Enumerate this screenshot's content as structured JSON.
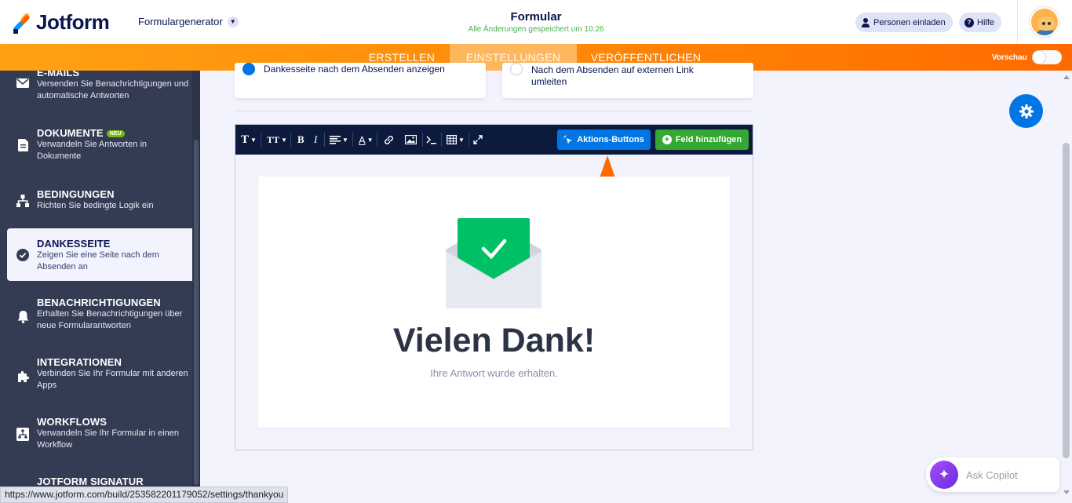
{
  "header": {
    "brand": "Jotform",
    "generator_label": "Formulargenerator",
    "form_title": "Formular",
    "save_status": "Alle Änderungen gespeichert um 10:26",
    "invite_label": "Personen einladen",
    "help_label": "Hilfe"
  },
  "nav": {
    "tabs": [
      {
        "label": "ERSTELLEN",
        "active": false
      },
      {
        "label": "EINSTELLUNGEN",
        "active": true
      },
      {
        "label": "VERÖFFENTLICHEN",
        "active": false
      }
    ],
    "preview_label": "Vorschau",
    "preview_on": false
  },
  "sidebar": {
    "items": [
      {
        "title": "E-MAILS",
        "desc": "Versenden Sie Benachrichtigungen und automatische Antworten",
        "icon": "envelope-icon"
      },
      {
        "title": "DOKUMENTE",
        "badge": "NEU",
        "desc": "Verwandeln Sie Antworten in Dokumente",
        "icon": "document-icon"
      },
      {
        "title": "BEDINGUNGEN",
        "desc": "Richten Sie bedingte Logik ein",
        "icon": "conditions-icon"
      },
      {
        "title": "DANKESSEITE",
        "desc": "Zeigen Sie eine Seite nach dem Absenden an",
        "icon": "check-circle-icon",
        "active": true
      },
      {
        "title": "BENACHRICHTIGUNGEN",
        "desc": "Erhalten Sie Benachrichtigungen über neue Formularantworten",
        "icon": "bell-icon"
      },
      {
        "title": "INTEGRATIONEN",
        "desc": "Verbinden Sie Ihr Formular mit anderen Apps",
        "icon": "puzzle-icon"
      },
      {
        "title": "WORKFLOWS",
        "desc": "Verwandeln Sie Ihr Formular in einen Workflow",
        "icon": "workflow-icon"
      },
      {
        "title": "JOTFORM SIGNATUR",
        "desc": "",
        "icon": "signature-icon"
      }
    ]
  },
  "options": {
    "show_page": "Dankesseite nach dem Absenden anzeigen",
    "redirect_line1": "Nach dem Absenden auf externen Link",
    "redirect_line2": "umleiten"
  },
  "editor": {
    "toolbar": {
      "text_glyph": "T",
      "size_glyph": "TT",
      "bold_glyph": "B",
      "italic_glyph": "I",
      "color_glyph": "A",
      "actions_button": "Aktions-Buttons",
      "add_field_button": "Feld hinzufügen"
    },
    "thankyou_title": "Vielen Dank!",
    "thankyou_subtitle": "Ihre Antwort wurde erhalten."
  },
  "copilot": {
    "label": "Ask Copilot"
  },
  "statusbar": {
    "url": "https://www.jotform.com/build/253582201179052/settings/thankyou"
  },
  "colors": {
    "brand_orange": "#ff6100",
    "action_blue": "#0075e3",
    "add_green": "#33a832",
    "sidebar_bg": "#343c54",
    "success_green": "#00c066"
  }
}
